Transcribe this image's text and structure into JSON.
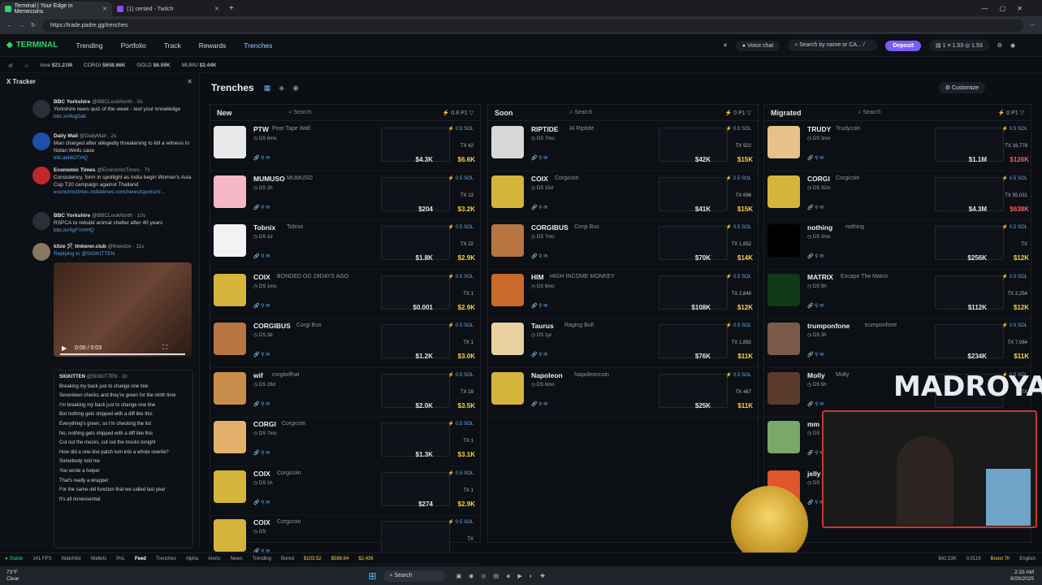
{
  "browser": {
    "tabs": [
      {
        "label": "Terminal | Your Edge in Memecoins"
      },
      {
        "label": "(1) cented - Twitch"
      }
    ],
    "url": "https://trade.padre.gg/trenches"
  },
  "app": {
    "logo": "TERMINAL",
    "nav": [
      "Trending",
      "Portfolio",
      "Track",
      "Rewards",
      "Trenches"
    ],
    "voice": "Voice chat",
    "search_placeholder": "Search by name or CA...",
    "search_key": "/",
    "deposit": "Deposit",
    "wallet": [
      "1",
      "1.53",
      "1.53"
    ]
  },
  "ticker": [
    {
      "label": "Ione",
      "value": "$21.21M"
    },
    {
      "label": "CORGI",
      "value": "$658.66K"
    },
    {
      "label": "GOLD",
      "value": "$6.59K"
    },
    {
      "label": "MUMU",
      "value": "$2.44K"
    }
  ],
  "tracker": {
    "title": "X Tracker",
    "tweets": [
      {
        "name": "BBC Yorkshire",
        "handle": "@BBCLookNorth · 0s",
        "text": "Yorkshire news quiz of the week - test your knowledge",
        "link": "bbc.in/4cg0all"
      },
      {
        "name": "Daily Mail",
        "handle": "@DailyMail · 2s",
        "text": "Man charged after allegedly threatening to kill a witness in Nolan Wells case",
        "link": "trib.al/t4OTHQ"
      },
      {
        "name": "Economic Times",
        "handle": "@EconomicTimes · 7s",
        "text": "Consistency, form in spotlight as India begin Women's Asia Cup T20 campaign against Thailand",
        "link": "economictimes.indiatimes.com/news/sports/cr..."
      },
      {
        "name": "BBC Yorkshire",
        "handle": "@BBCLookNorth · 10s",
        "text": "RSPCA to rebuild animal shelter after 40 years",
        "link": "bbc.in/4gFVmHQ"
      },
      {
        "name": "kitze 🛠️ tinkerer.club",
        "handle": "@thekitze · 11s",
        "text": "Replying to @SIGKITTEN",
        "link": ""
      }
    ],
    "video_time": "0:00 / 0:03",
    "quoted": {
      "name": "SIGKITTEN",
      "handle": "@SIGKITTEN · 1h",
      "lines": [
        "Breaking my back just to change one line",
        "Seventeen checks and they're green for the ninth time",
        "I'm breaking my back just to change one line",
        "But nothing gets shipped with a diff like this",
        "Everything's green, so I'm checking the list",
        "No, nothing gets shipped with a diff like this",
        "Cut out the mocks, cut out the mocks tonight",
        "How did a one-line patch turn into a whole rewrite?",
        "Somebody told me",
        "You wrote a helper",
        "That's really a wrapper",
        "For the same old function that we called last year",
        "It's all nonessential"
      ]
    }
  },
  "trenches": {
    "title": "Trenches",
    "customize": "Customize"
  },
  "columns": [
    {
      "title": "New",
      "search": "Search",
      "stats": [
        "0.8",
        "P1"
      ],
      "rows": [
        {
          "sym": "PTW",
          "name": "Pear Tape Wall",
          "age": "6mo",
          "tx": "42",
          "vol": "$4.3K",
          "mc": "$6.6K",
          "mcColor": "yellow",
          "img": "#e8e8e8"
        },
        {
          "sym": "MUMUSO",
          "name": "MUMUSO",
          "age": "2h",
          "tx": "13",
          "vol": "$204",
          "mc": "$3.2K",
          "mcColor": "yellow",
          "img": "#f4b7c6"
        },
        {
          "sym": "Tobnix",
          "name": "Tobnix",
          "age": "1d",
          "tx": "22",
          "vol": "$1.8K",
          "mc": "$2.9K",
          "mcColor": "yellow",
          "img": "#f2f2f2"
        },
        {
          "sym": "COIX",
          "name": "BONDED OG 29DAYS AGO",
          "age": "1mo",
          "tx": "1",
          "vol": "$0.001",
          "mc": "$2.9K",
          "mcColor": "yellow",
          "img": "#d4b43a"
        },
        {
          "sym": "CORGIBUS",
          "name": "Corgi Bus",
          "age": "3d",
          "tx": "1",
          "vol": "$1.2K",
          "mc": "$3.0K",
          "mcColor": "yellow",
          "img": "#b87542"
        },
        {
          "sym": "wif",
          "name": "corgiwifhat",
          "age": "28d",
          "tx": "19",
          "vol": "$2.0K",
          "mc": "$3.5K",
          "mcColor": "yellow",
          "img": "#c98d4b"
        },
        {
          "sym": "CORGI",
          "name": "Corgicoin",
          "age": "7mo",
          "tx": "1",
          "vol": "$1.3K",
          "mc": "$3.1K",
          "mcColor": "yellow",
          "img": "#e3b06b"
        },
        {
          "sym": "COIX",
          "name": "Corgicoin",
          "age": "1h",
          "tx": "1",
          "vol": "$274",
          "mc": "$2.9K",
          "mcColor": "yellow",
          "img": "#d4b43a"
        },
        {
          "sym": "COIX",
          "name": "Corgicoin",
          "age": "",
          "tx": "",
          "vol": "",
          "mc": "",
          "mcColor": "yellow",
          "img": "#d4b43a"
        }
      ]
    },
    {
      "title": "Soon",
      "search": "Search",
      "stats": [
        "0",
        "P1"
      ],
      "rows": [
        {
          "sym": "RIPTIDE",
          "name": "AI Riptide",
          "age": "7mo",
          "tx": "922",
          "vol": "$42K",
          "mc": "$15K",
          "mcColor": "yellow",
          "img": "#d8d8d8"
        },
        {
          "sym": "COIX",
          "name": "Corgicoin",
          "age": "15d",
          "tx": "696",
          "vol": "$41K",
          "mc": "$15K",
          "mcColor": "yellow",
          "img": "#d4b43a"
        },
        {
          "sym": "CORGIBUS",
          "name": "Corgi Bus",
          "age": "7mo",
          "tx": "1,652",
          "vol": "$70K",
          "mc": "$14K",
          "mcColor": "yellow",
          "img": "#b87542"
        },
        {
          "sym": "HIM",
          "name": "HIGH INCOME MONKEY",
          "age": "6mo",
          "tx": "2,849",
          "vol": "$108K",
          "mc": "$12K",
          "mcColor": "yellow",
          "img": "#c96a2a"
        },
        {
          "sym": "Taurus",
          "name": "Raging Bull",
          "age": "1yr",
          "tx": "1,892",
          "vol": "$76K",
          "mc": "$11K",
          "mcColor": "yellow",
          "img": "#e8d0a0"
        },
        {
          "sym": "Napoleon",
          "name": "Napoleoncoin",
          "age": "6mo",
          "tx": "467",
          "vol": "$25K",
          "mc": "$11K",
          "mcColor": "yellow",
          "img": "#d4b43a"
        }
      ]
    },
    {
      "title": "Migrated",
      "search": "Search",
      "stats": [
        "0",
        "P1"
      ],
      "rows": [
        {
          "sym": "TRUDY",
          "name": "Trudycoin",
          "age": "3mo",
          "tx": "16,778",
          "vol": "$1.1M",
          "mc": "$126K",
          "mcColor": "red",
          "img": "#e8c08a"
        },
        {
          "sym": "CORGI",
          "name": "Corgicoin",
          "age": "32m",
          "tx": "55,031",
          "vol": "$4.3M",
          "mc": "$638K",
          "mcColor": "red",
          "img": "#d4b43a"
        },
        {
          "sym": "nothing",
          "name": "nothing",
          "age": "2mo",
          "tx": "",
          "vol": "$256K",
          "mc": "$12K",
          "mcColor": "yellow",
          "img": "#000000"
        },
        {
          "sym": "MATRIX",
          "name": "Escape The Matrix",
          "age": "5h",
          "tx": "2,254",
          "vol": "$112K",
          "mc": "$12K",
          "mcColor": "yellow",
          "img": "#0e3a16"
        },
        {
          "sym": "trumponfone",
          "name": "trumponfone",
          "age": "3h",
          "tx": "7,064",
          "vol": "$234K",
          "mc": "$11K",
          "mcColor": "yellow",
          "img": "#7a5a4a"
        },
        {
          "sym": "Molly",
          "name": "Molly",
          "age": "5h",
          "tx": "",
          "vol": "",
          "mc": "",
          "mcColor": "yellow",
          "img": "#5a3a2a"
        },
        {
          "sym": "mm",
          "name": "",
          "age": "",
          "tx": "",
          "vol": "",
          "mc": "",
          "mcColor": "yellow",
          "img": "#7aa868"
        },
        {
          "sym": "jelly",
          "name": "",
          "age": "10mo",
          "tx": "",
          "vol": "",
          "mc": "",
          "mcColor": "yellow",
          "img": "#e0552a"
        }
      ]
    }
  ],
  "row_sol": "0.5 SOL",
  "overlay": {
    "madroyals": "MADROYALS"
  },
  "bottombar": {
    "status": "Stable",
    "fps": "141 FPS",
    "items": [
      "Watchlist",
      "Wallets",
      "PnL",
      "Feed",
      "Trenches",
      "Alpha",
      "Alerts",
      "News",
      "Trending",
      "Bored"
    ],
    "prices": [
      "$103.52",
      "$588.64",
      "$2,436"
    ],
    "right": [
      "$42.53K",
      "0.0119",
      "Boost 7h",
      "English"
    ]
  },
  "taskbar": {
    "weather": "73°F",
    "weather2": "Clear",
    "search": "Search",
    "time": "2:33 AM",
    "date": "8/29/2025"
  }
}
